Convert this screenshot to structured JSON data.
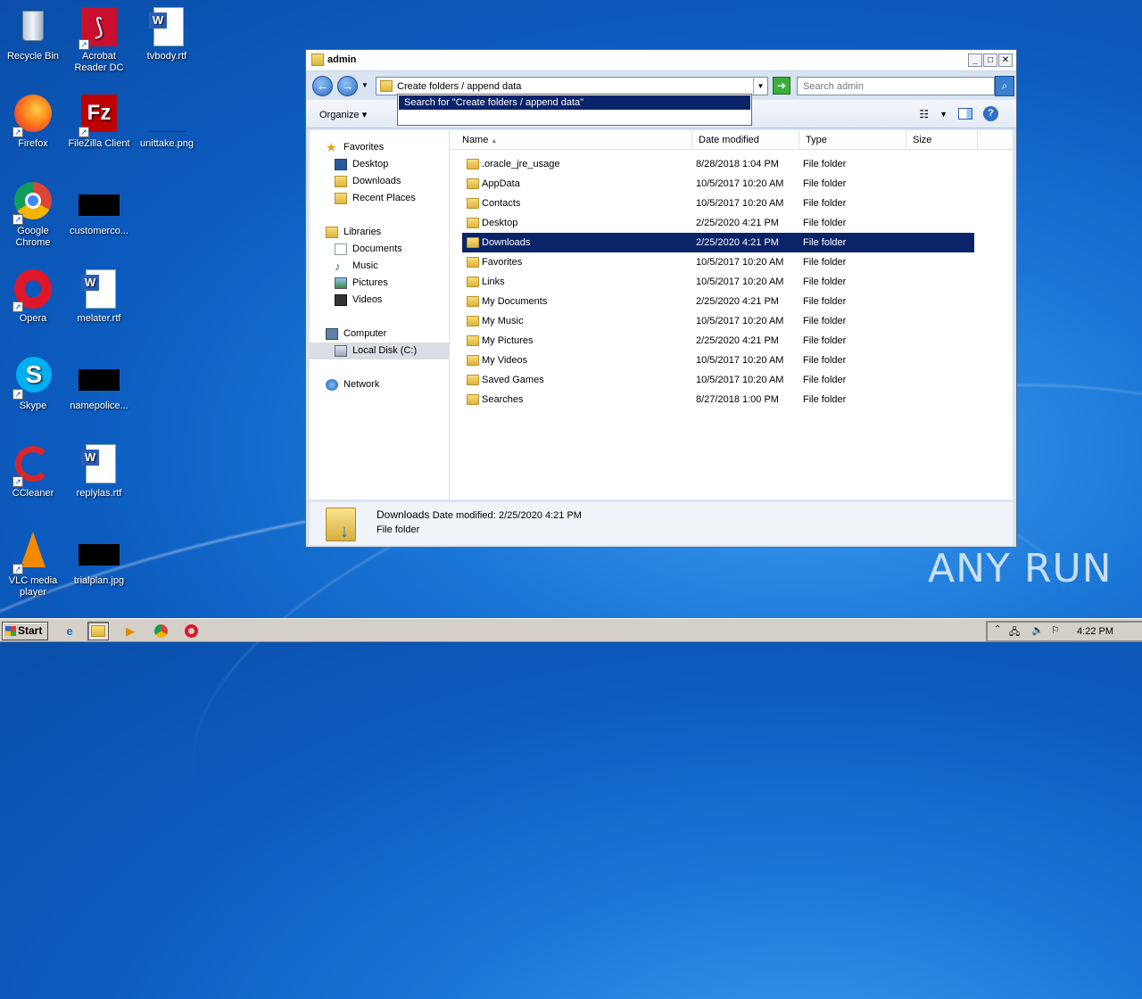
{
  "desktop": {
    "icons": [
      {
        "label": "Recycle Bin"
      },
      {
        "label": "Acrobat Reader DC"
      },
      {
        "label": "tvbody.rtf"
      },
      {
        "label": "Firefox"
      },
      {
        "label": "FileZilla Client"
      },
      {
        "label": "unittake.png"
      },
      {
        "label": "Google Chrome"
      },
      {
        "label": "customerco..."
      },
      {
        "label": "Opera"
      },
      {
        "label": "melater.rtf"
      },
      {
        "label": "Skype"
      },
      {
        "label": "namepolice..."
      },
      {
        "label": "CCleaner"
      },
      {
        "label": "replylas.rtf"
      },
      {
        "label": "VLC media player"
      },
      {
        "label": "trialplan.jpg"
      }
    ]
  },
  "window": {
    "title": "admin",
    "address": "Create folders / append data",
    "search_placeholder": "Search admin",
    "suggestion": "Search for \"Create folders / append data\"",
    "toolbar": {
      "organize": "Organize"
    },
    "nav": {
      "favorites": "Favorites",
      "desktop": "Desktop",
      "downloads": "Downloads",
      "recent": "Recent Places",
      "libraries": "Libraries",
      "documents": "Documents",
      "music": "Music",
      "pictures": "Pictures",
      "videos": "Videos",
      "computer": "Computer",
      "localdisk": "Local Disk (C:)",
      "network": "Network"
    },
    "columns": {
      "name": "Name",
      "date": "Date modified",
      "type": "Type",
      "size": "Size"
    },
    "files": [
      {
        "name": ".oracle_jre_usage",
        "date": "8/28/2018 1:04 PM",
        "type": "File folder"
      },
      {
        "name": "AppData",
        "date": "10/5/2017 10:20 AM",
        "type": "File folder"
      },
      {
        "name": "Contacts",
        "date": "10/5/2017 10:20 AM",
        "type": "File folder"
      },
      {
        "name": "Desktop",
        "date": "2/25/2020 4:21 PM",
        "type": "File folder"
      },
      {
        "name": "Downloads",
        "date": "2/25/2020 4:21 PM",
        "type": "File folder"
      },
      {
        "name": "Favorites",
        "date": "10/5/2017 10:20 AM",
        "type": "File folder"
      },
      {
        "name": "Links",
        "date": "10/5/2017 10:20 AM",
        "type": "File folder"
      },
      {
        "name": "My Documents",
        "date": "2/25/2020 4:21 PM",
        "type": "File folder"
      },
      {
        "name": "My Music",
        "date": "10/5/2017 10:20 AM",
        "type": "File folder"
      },
      {
        "name": "My Pictures",
        "date": "2/25/2020 4:21 PM",
        "type": "File folder"
      },
      {
        "name": "My Videos",
        "date": "10/5/2017 10:20 AM",
        "type": "File folder"
      },
      {
        "name": "Saved Games",
        "date": "10/5/2017 10:20 AM",
        "type": "File folder"
      },
      {
        "name": "Searches",
        "date": "8/27/2018 1:00 PM",
        "type": "File folder"
      }
    ],
    "details": {
      "name": "Downloads",
      "date_label": "Date modified:",
      "date": "2/25/2020 4:21 PM",
      "type": "File folder"
    }
  },
  "taskbar": {
    "start": "Start",
    "clock": "4:22 PM"
  },
  "watermark": "ANY RUN"
}
